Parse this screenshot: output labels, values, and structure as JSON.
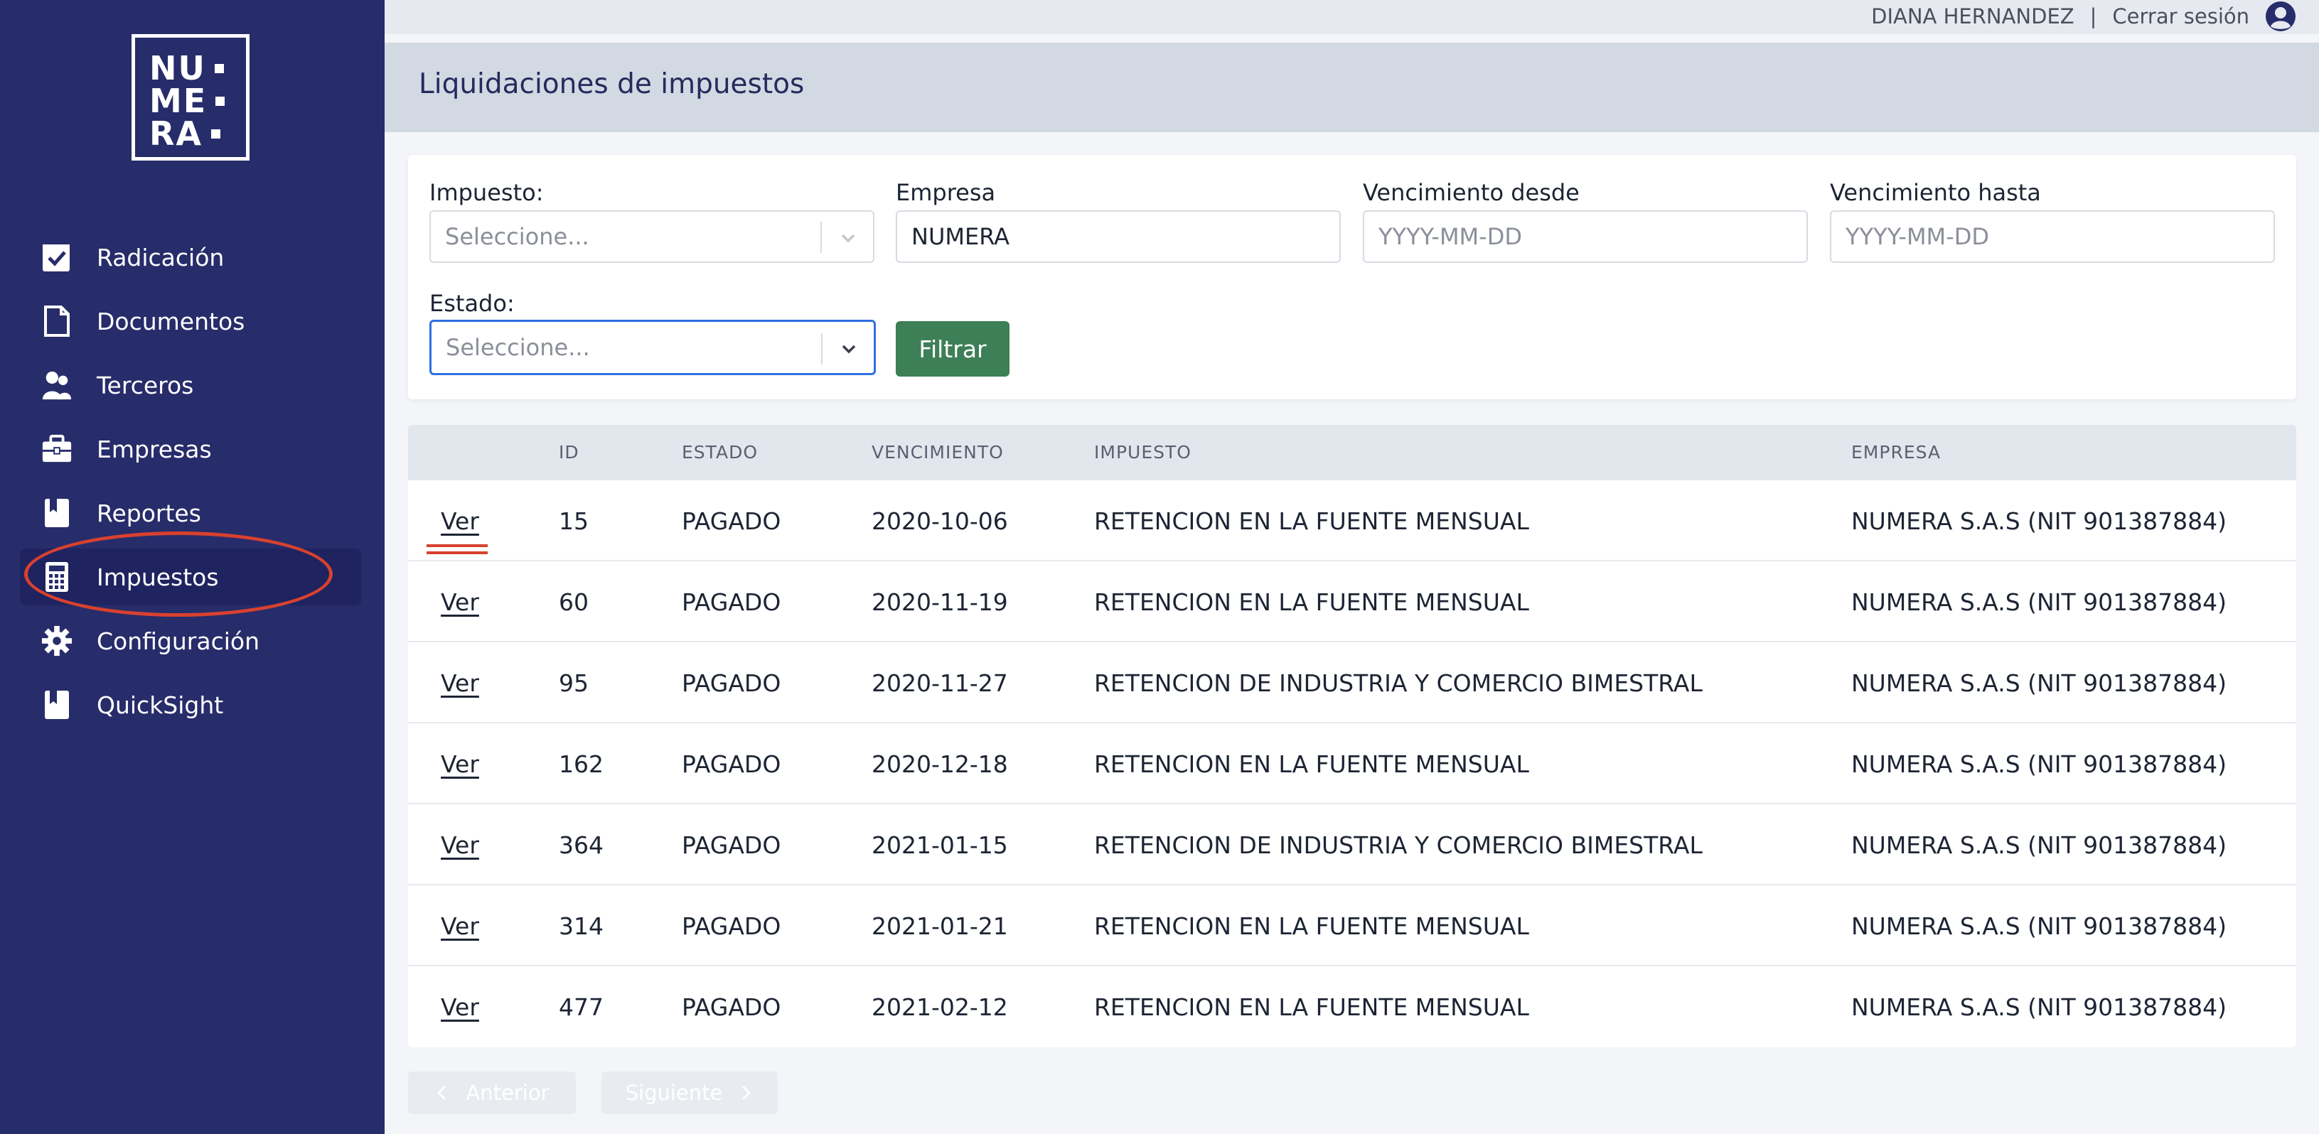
{
  "brand": {
    "logo_line1": "NU",
    "logo_line2": "ME",
    "logo_line3": "RA"
  },
  "sidebar": {
    "items": [
      {
        "label": "Radicación",
        "icon": "check-square-icon"
      },
      {
        "label": "Documentos",
        "icon": "document-icon"
      },
      {
        "label": "Terceros",
        "icon": "users-icon"
      },
      {
        "label": "Empresas",
        "icon": "briefcase-icon"
      },
      {
        "label": "Reportes",
        "icon": "bookmark-icon"
      },
      {
        "label": "Impuestos",
        "icon": "calculator-icon",
        "active": true
      },
      {
        "label": "Configuración",
        "icon": "gear-icon"
      },
      {
        "label": "QuickSight",
        "icon": "bookmark-icon"
      }
    ]
  },
  "topbar": {
    "user_name": "DIANA HERNANDEZ",
    "separator": "|",
    "logout": "Cerrar sesión"
  },
  "page": {
    "title": "Liquidaciones de impuestos"
  },
  "filters": {
    "impuesto": {
      "label": "Impuesto:",
      "placeholder": "Seleccione..."
    },
    "empresa": {
      "label": "Empresa",
      "value": "NUMERA"
    },
    "venc_desde": {
      "label": "Vencimiento desde",
      "placeholder": "YYYY-MM-DD"
    },
    "venc_hasta": {
      "label": "Vencimiento hasta",
      "placeholder": "YYYY-MM-DD"
    },
    "estado": {
      "label": "Estado:",
      "placeholder": "Seleccione..."
    },
    "filter_button": "Filtrar"
  },
  "table": {
    "headers": [
      "ID",
      "ESTADO",
      "VENCIMIENTO",
      "IMPUESTO",
      "EMPRESA"
    ],
    "rows": [
      {
        "action": "Ver",
        "id": "15",
        "estado": "PAGADO",
        "vencimiento": "2020-10-06",
        "impuesto": "RETENCION EN LA FUENTE MENSUAL",
        "empresa": "NUMERA S.A.S (NIT 901387884)"
      },
      {
        "action": "Ver",
        "id": "60",
        "estado": "PAGADO",
        "vencimiento": "2020-11-19",
        "impuesto": "RETENCION EN LA FUENTE MENSUAL",
        "empresa": "NUMERA S.A.S (NIT 901387884)"
      },
      {
        "action": "Ver",
        "id": "95",
        "estado": "PAGADO",
        "vencimiento": "2020-11-27",
        "impuesto": "RETENCION DE INDUSTRIA Y COMERCIO BIMESTRAL",
        "empresa": "NUMERA S.A.S (NIT 901387884)"
      },
      {
        "action": "Ver",
        "id": "162",
        "estado": "PAGADO",
        "vencimiento": "2020-12-18",
        "impuesto": "RETENCION EN LA FUENTE MENSUAL",
        "empresa": "NUMERA S.A.S (NIT 901387884)"
      },
      {
        "action": "Ver",
        "id": "364",
        "estado": "PAGADO",
        "vencimiento": "2021-01-15",
        "impuesto": "RETENCION DE INDUSTRIA Y COMERCIO BIMESTRAL",
        "empresa": "NUMERA S.A.S (NIT 901387884)"
      },
      {
        "action": "Ver",
        "id": "314",
        "estado": "PAGADO",
        "vencimiento": "2021-01-21",
        "impuesto": "RETENCION EN LA FUENTE MENSUAL",
        "empresa": "NUMERA S.A.S (NIT 901387884)"
      },
      {
        "action": "Ver",
        "id": "477",
        "estado": "PAGADO",
        "vencimiento": "2021-02-12",
        "impuesto": "RETENCION EN LA FUENTE MENSUAL",
        "empresa": "NUMERA S.A.S (NIT 901387884)"
      }
    ]
  },
  "pagination": {
    "prev": "Anterior",
    "next": "Siguiente"
  },
  "colors": {
    "sidebar_bg": "#272c6a",
    "accent_button": "#3d7f56",
    "annotation_red": "#d8412f",
    "focus_blue": "#2f6fe0"
  }
}
